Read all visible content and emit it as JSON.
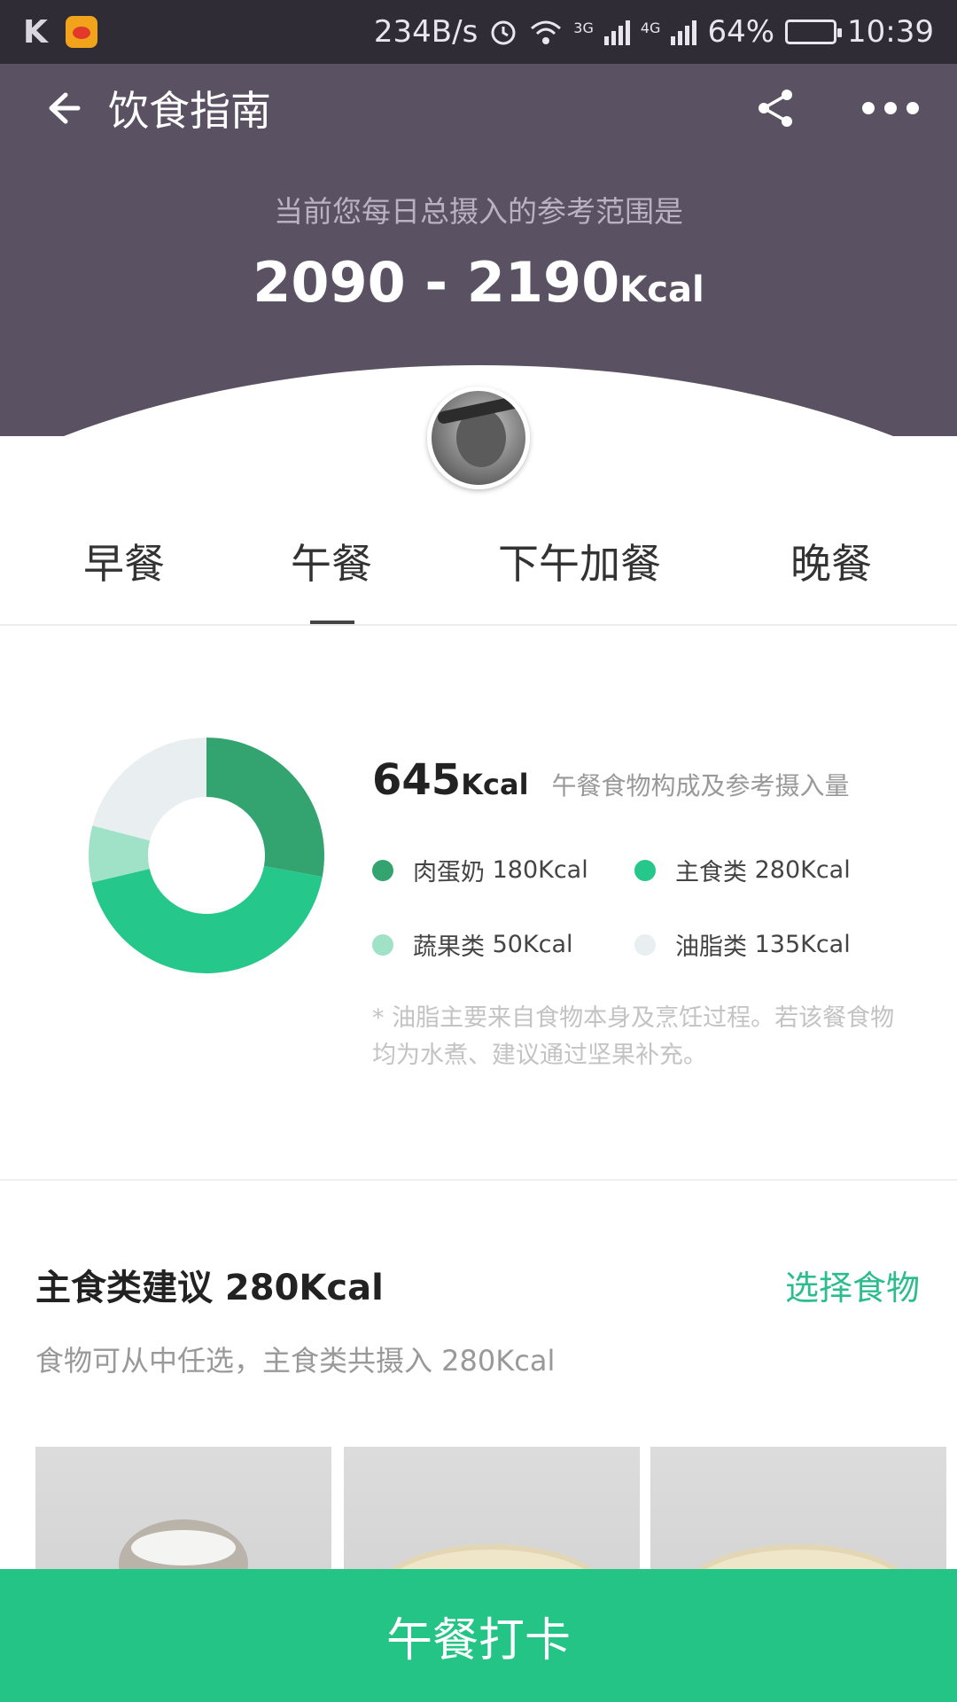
{
  "status_bar": {
    "speed": "234B/s",
    "net_3g": "3G",
    "net_4g": "4G",
    "battery": "64%",
    "battery_level": 0.64,
    "time": "10:39"
  },
  "header": {
    "title": "饮食指南",
    "icons": [
      "back-arrow-icon",
      "share-icon",
      "more-icon"
    ]
  },
  "hero": {
    "caption": "当前您每日总摄入的参考范围是",
    "range": "2090 - 2190",
    "unit": "Kcal"
  },
  "tabs": [
    {
      "label": "早餐"
    },
    {
      "label": "午餐",
      "active": true
    },
    {
      "label": "下午加餐"
    },
    {
      "label": "晚餐"
    }
  ],
  "meal_summary": {
    "value": "645",
    "unit": "Kcal",
    "caption": "午餐食物构成及参考摄入量",
    "legend": [
      {
        "name": "肉蛋奶",
        "value": "180Kcal",
        "kcal": 180,
        "color": "#33a46f"
      },
      {
        "name": "主食类",
        "value": "280Kcal",
        "kcal": 280,
        "color": "#25c78a"
      },
      {
        "name": "蔬果类",
        "value": "50Kcal",
        "kcal": 50,
        "color": "#9fe2c7"
      },
      {
        "name": "油脂类",
        "value": "135Kcal",
        "kcal": 135,
        "color": "#e9eef0"
      }
    ],
    "note": "* 油脂主要来自食物本身及烹饪过程。若该餐食物均为水煮、建议通过坚果补充。"
  },
  "staple_section": {
    "title": "主食类建议 280Kcal",
    "action": "选择食物",
    "subtitle": "食物可从中任选，主食类共摄入 280Kcal"
  },
  "cta": {
    "label": "午餐打卡"
  },
  "colors": {
    "hero": "#5a5163",
    "accent": "#24c486"
  }
}
